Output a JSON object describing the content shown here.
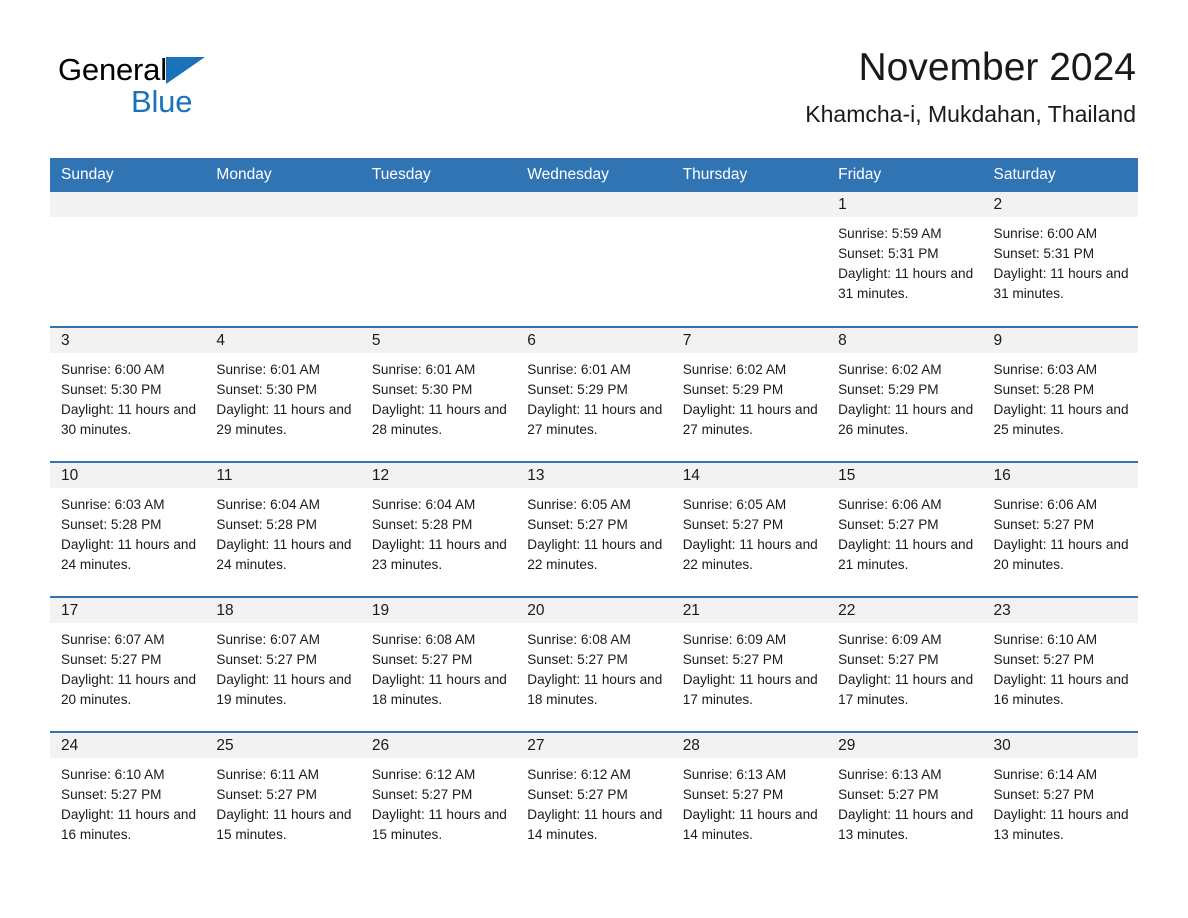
{
  "logo": {
    "word1": "General",
    "word2": "Blue",
    "triangle_color": "#1b72b8",
    "text_color": "#000000"
  },
  "header": {
    "month_title": "November 2024",
    "location": "Khamcha-i, Mukdahan, Thailand"
  },
  "theme": {
    "header_blue": "#3174b4",
    "daynum_band": "#f2f2f2",
    "text": "#1a1a1a"
  },
  "calendar": {
    "weekday_headers": [
      "Sunday",
      "Monday",
      "Tuesday",
      "Wednesday",
      "Thursday",
      "Friday",
      "Saturday"
    ],
    "weeks": [
      [
        {
          "day": "",
          "sunrise": "",
          "sunset": "",
          "daylight": ""
        },
        {
          "day": "",
          "sunrise": "",
          "sunset": "",
          "daylight": ""
        },
        {
          "day": "",
          "sunrise": "",
          "sunset": "",
          "daylight": ""
        },
        {
          "day": "",
          "sunrise": "",
          "sunset": "",
          "daylight": ""
        },
        {
          "day": "",
          "sunrise": "",
          "sunset": "",
          "daylight": ""
        },
        {
          "day": "1",
          "sunrise": "Sunrise: 5:59 AM",
          "sunset": "Sunset: 5:31 PM",
          "daylight": "Daylight: 11 hours and 31 minutes."
        },
        {
          "day": "2",
          "sunrise": "Sunrise: 6:00 AM",
          "sunset": "Sunset: 5:31 PM",
          "daylight": "Daylight: 11 hours and 31 minutes."
        }
      ],
      [
        {
          "day": "3",
          "sunrise": "Sunrise: 6:00 AM",
          "sunset": "Sunset: 5:30 PM",
          "daylight": "Daylight: 11 hours and 30 minutes."
        },
        {
          "day": "4",
          "sunrise": "Sunrise: 6:01 AM",
          "sunset": "Sunset: 5:30 PM",
          "daylight": "Daylight: 11 hours and 29 minutes."
        },
        {
          "day": "5",
          "sunrise": "Sunrise: 6:01 AM",
          "sunset": "Sunset: 5:30 PM",
          "daylight": "Daylight: 11 hours and 28 minutes."
        },
        {
          "day": "6",
          "sunrise": "Sunrise: 6:01 AM",
          "sunset": "Sunset: 5:29 PM",
          "daylight": "Daylight: 11 hours and 27 minutes."
        },
        {
          "day": "7",
          "sunrise": "Sunrise: 6:02 AM",
          "sunset": "Sunset: 5:29 PM",
          "daylight": "Daylight: 11 hours and 27 minutes."
        },
        {
          "day": "8",
          "sunrise": "Sunrise: 6:02 AM",
          "sunset": "Sunset: 5:29 PM",
          "daylight": "Daylight: 11 hours and 26 minutes."
        },
        {
          "day": "9",
          "sunrise": "Sunrise: 6:03 AM",
          "sunset": "Sunset: 5:28 PM",
          "daylight": "Daylight: 11 hours and 25 minutes."
        }
      ],
      [
        {
          "day": "10",
          "sunrise": "Sunrise: 6:03 AM",
          "sunset": "Sunset: 5:28 PM",
          "daylight": "Daylight: 11 hours and 24 minutes."
        },
        {
          "day": "11",
          "sunrise": "Sunrise: 6:04 AM",
          "sunset": "Sunset: 5:28 PM",
          "daylight": "Daylight: 11 hours and 24 minutes."
        },
        {
          "day": "12",
          "sunrise": "Sunrise: 6:04 AM",
          "sunset": "Sunset: 5:28 PM",
          "daylight": "Daylight: 11 hours and 23 minutes."
        },
        {
          "day": "13",
          "sunrise": "Sunrise: 6:05 AM",
          "sunset": "Sunset: 5:27 PM",
          "daylight": "Daylight: 11 hours and 22 minutes."
        },
        {
          "day": "14",
          "sunrise": "Sunrise: 6:05 AM",
          "sunset": "Sunset: 5:27 PM",
          "daylight": "Daylight: 11 hours and 22 minutes."
        },
        {
          "day": "15",
          "sunrise": "Sunrise: 6:06 AM",
          "sunset": "Sunset: 5:27 PM",
          "daylight": "Daylight: 11 hours and 21 minutes."
        },
        {
          "day": "16",
          "sunrise": "Sunrise: 6:06 AM",
          "sunset": "Sunset: 5:27 PM",
          "daylight": "Daylight: 11 hours and 20 minutes."
        }
      ],
      [
        {
          "day": "17",
          "sunrise": "Sunrise: 6:07 AM",
          "sunset": "Sunset: 5:27 PM",
          "daylight": "Daylight: 11 hours and 20 minutes."
        },
        {
          "day": "18",
          "sunrise": "Sunrise: 6:07 AM",
          "sunset": "Sunset: 5:27 PM",
          "daylight": "Daylight: 11 hours and 19 minutes."
        },
        {
          "day": "19",
          "sunrise": "Sunrise: 6:08 AM",
          "sunset": "Sunset: 5:27 PM",
          "daylight": "Daylight: 11 hours and 18 minutes."
        },
        {
          "day": "20",
          "sunrise": "Sunrise: 6:08 AM",
          "sunset": "Sunset: 5:27 PM",
          "daylight": "Daylight: 11 hours and 18 minutes."
        },
        {
          "day": "21",
          "sunrise": "Sunrise: 6:09 AM",
          "sunset": "Sunset: 5:27 PM",
          "daylight": "Daylight: 11 hours and 17 minutes."
        },
        {
          "day": "22",
          "sunrise": "Sunrise: 6:09 AM",
          "sunset": "Sunset: 5:27 PM",
          "daylight": "Daylight: 11 hours and 17 minutes."
        },
        {
          "day": "23",
          "sunrise": "Sunrise: 6:10 AM",
          "sunset": "Sunset: 5:27 PM",
          "daylight": "Daylight: 11 hours and 16 minutes."
        }
      ],
      [
        {
          "day": "24",
          "sunrise": "Sunrise: 6:10 AM",
          "sunset": "Sunset: 5:27 PM",
          "daylight": "Daylight: 11 hours and 16 minutes."
        },
        {
          "day": "25",
          "sunrise": "Sunrise: 6:11 AM",
          "sunset": "Sunset: 5:27 PM",
          "daylight": "Daylight: 11 hours and 15 minutes."
        },
        {
          "day": "26",
          "sunrise": "Sunrise: 6:12 AM",
          "sunset": "Sunset: 5:27 PM",
          "daylight": "Daylight: 11 hours and 15 minutes."
        },
        {
          "day": "27",
          "sunrise": "Sunrise: 6:12 AM",
          "sunset": "Sunset: 5:27 PM",
          "daylight": "Daylight: 11 hours and 14 minutes."
        },
        {
          "day": "28",
          "sunrise": "Sunrise: 6:13 AM",
          "sunset": "Sunset: 5:27 PM",
          "daylight": "Daylight: 11 hours and 14 minutes."
        },
        {
          "day": "29",
          "sunrise": "Sunrise: 6:13 AM",
          "sunset": "Sunset: 5:27 PM",
          "daylight": "Daylight: 11 hours and 13 minutes."
        },
        {
          "day": "30",
          "sunrise": "Sunrise: 6:14 AM",
          "sunset": "Sunset: 5:27 PM",
          "daylight": "Daylight: 11 hours and 13 minutes."
        }
      ]
    ]
  }
}
